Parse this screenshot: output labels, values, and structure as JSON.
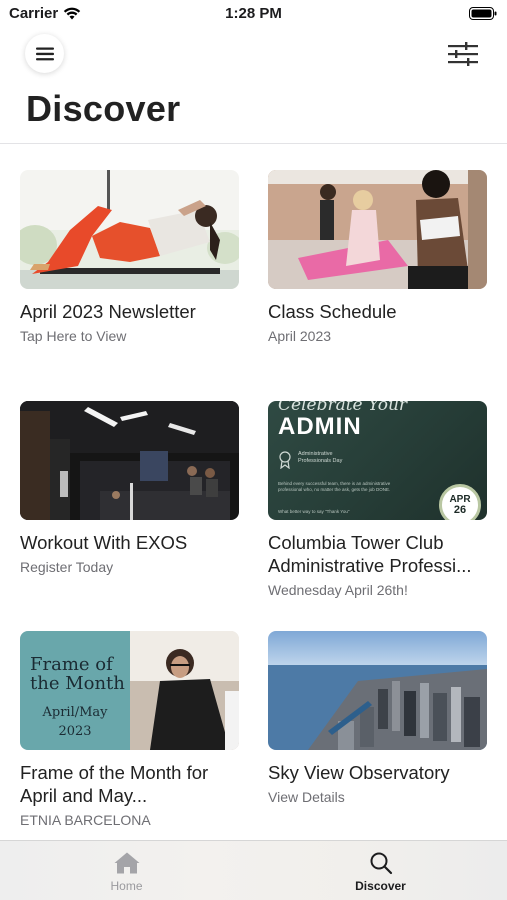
{
  "status_bar": {
    "carrier": "Carrier",
    "time": "1:28 PM"
  },
  "header": {
    "title": "Discover",
    "menu_icon": "hamburger-icon",
    "filter_icon": "sliders-icon"
  },
  "cards": [
    {
      "title": "April 2023 Newsletter",
      "subtitle": "Tap Here to View"
    },
    {
      "title": "Class Schedule",
      "subtitle": "April 2023"
    },
    {
      "title": "Workout With EXOS",
      "subtitle": "Register Today"
    },
    {
      "title": "Columbia Tower Club Administrative Professi...",
      "subtitle": "Wednesday April 26th!"
    },
    {
      "title": "Frame of the Month for April and May...",
      "subtitle": "ETNIA BARCELONA"
    },
    {
      "title": "Sky View Observatory",
      "subtitle": "View Details"
    }
  ],
  "card_images": {
    "admin": {
      "heading": "Celebrate Your",
      "title": "ADMIN",
      "day_label": "Administrative Professionals Day",
      "body": "Behind every successful team, there is an administrative professional who, no matter the ask, gets the job DONE.",
      "footer": "What better way to say \"Thank You\"",
      "badge_month": "APR",
      "badge_day": "26"
    },
    "frame": {
      "line1": "Frame of",
      "line2": "the Month",
      "line3": "April/May",
      "line4": "2023"
    }
  },
  "tab_bar": {
    "tabs": [
      {
        "label": "Home",
        "icon": "home-icon",
        "active": false
      },
      {
        "label": "Discover",
        "icon": "search-icon",
        "active": true
      }
    ]
  },
  "colors": {
    "accent_text": "#1c1c1e",
    "secondary_text": "#6e6e73",
    "admin_green": "#2f4a43",
    "frame_teal": "#69a7ab"
  }
}
